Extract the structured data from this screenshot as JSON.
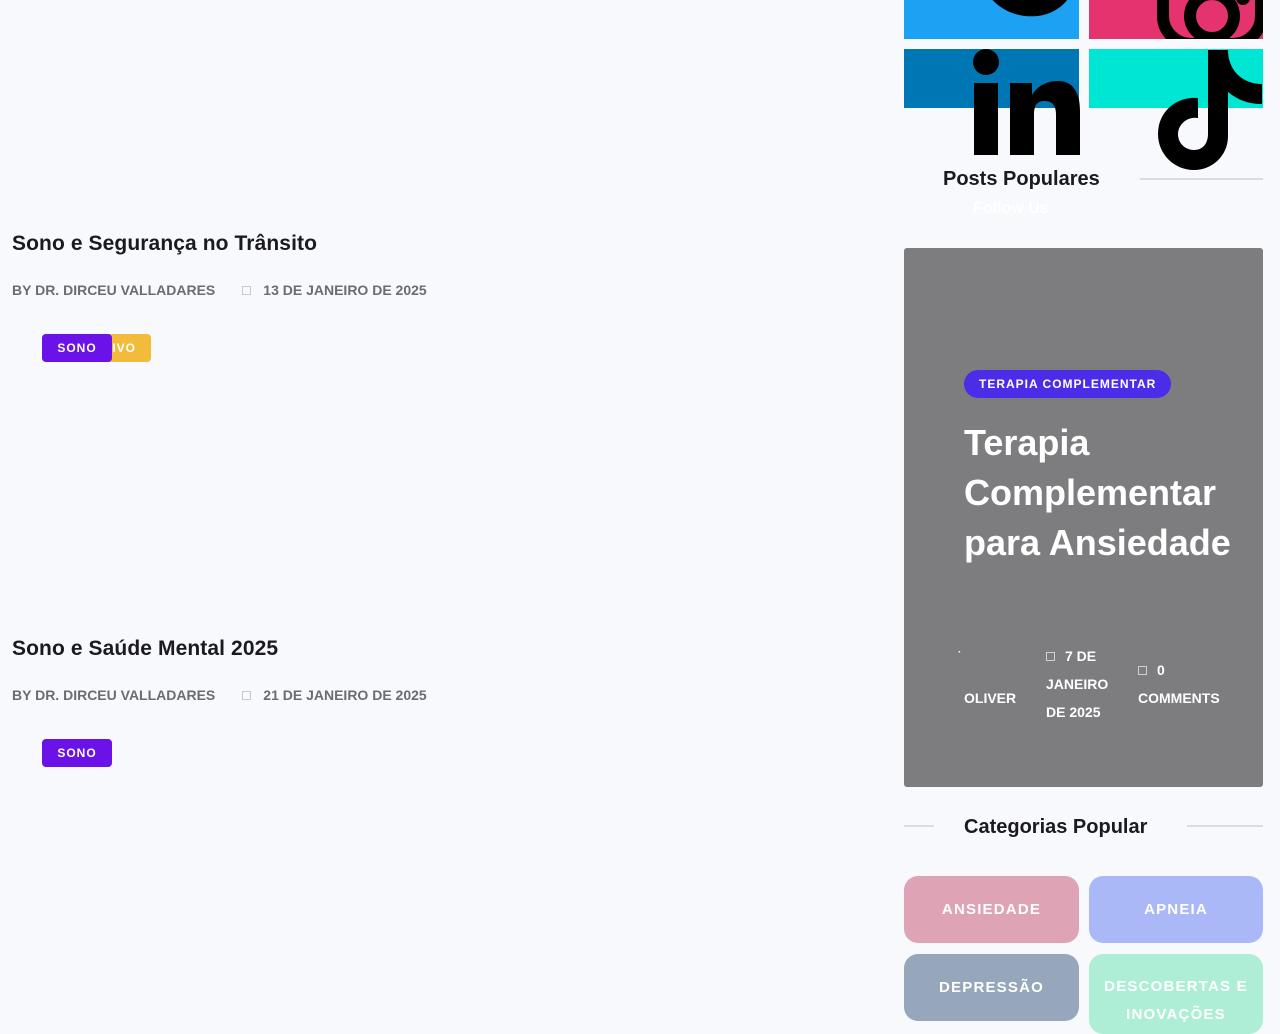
{
  "posts": [
    {
      "title": "Sono e Segurança no Trânsito",
      "author": "BY DR. DIRCEU VALLADARES",
      "date": "13 DE JANEIRO DE 2025",
      "tags": [
        "SONO",
        "IVO"
      ]
    },
    {
      "title": "Sono e Saúde Mental 2025",
      "author": "BY DR. DIRCEU VALLADARES",
      "date": "21 DE JANEIRO DE 2025",
      "tags": [
        "SONO"
      ]
    }
  ],
  "social": {
    "tiles": [
      {
        "name": "twitter",
        "color": "#1da1f2",
        "icon": "twitter-icon"
      },
      {
        "name": "instagram",
        "color": "#e4336f",
        "icon": "instagram-icon"
      },
      {
        "name": "linkedin",
        "color": "#0077b5",
        "icon": "linkedin-icon"
      },
      {
        "name": "tiktok",
        "color": "#00e6d4",
        "icon": "tiktok-icon"
      }
    ]
  },
  "sidebar": {
    "popular_posts_heading": "Posts Populares",
    "popular_posts_ghost": "Follow Us",
    "featured": {
      "tag": "TERAPIA COMPLEMENTAR",
      "title": "Terapia Complementar para Ansiedade",
      "author": "OLIVER",
      "date": "7 DE JANEIRO DE 2025",
      "comments": "0 COMMENTS"
    },
    "categories_heading": "Categorias Popular",
    "categories": [
      {
        "label": "ANSIEDADE",
        "color": "#dfa3b6"
      },
      {
        "label": "APNEIA",
        "color": "#aab8f8"
      },
      {
        "label": "DEPRESSÃO",
        "color": "#97a7bb"
      },
      {
        "label": "DESCOBERTAS E INOVAÇÕES",
        "color": "#aeeed6"
      }
    ]
  },
  "colors": {
    "background": "#f8f9fd",
    "tag_purple": "#6a12e8",
    "tag_yellow": "#f2bb3a",
    "featured_bg": "#7d7d80",
    "featured_tag": "#4b2ce8"
  }
}
